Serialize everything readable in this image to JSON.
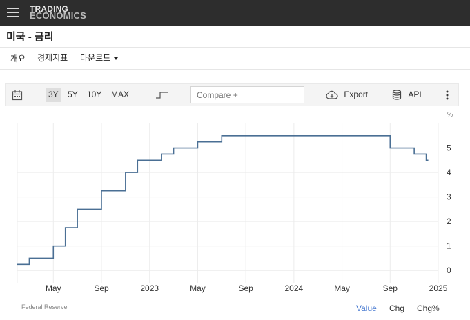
{
  "header": {
    "logo_line1": "TRADING",
    "logo_line2": "ECONOMICS"
  },
  "page": {
    "title": "미국 - 금리"
  },
  "tabs": [
    {
      "label": "개요",
      "active": true
    },
    {
      "label": "경제지표",
      "active": false
    },
    {
      "label": "다운로드",
      "active": false
    }
  ],
  "toolbar": {
    "ranges": [
      "3Y",
      "5Y",
      "10Y",
      "MAX"
    ],
    "selected_range": "3Y",
    "compare_placeholder": "Compare +",
    "export_label": "Export",
    "api_label": "API"
  },
  "chart_data": {
    "type": "line",
    "line_style": "step",
    "ylabel": "%",
    "ylim": [
      -0.5,
      6
    ],
    "y_ticks": [
      0,
      1,
      2,
      3,
      4,
      5
    ],
    "x_ticks": [
      "May",
      "Sep",
      "2023",
      "May",
      "Sep",
      "2024",
      "May",
      "Sep",
      "2025"
    ],
    "grid": true,
    "color": "#4a6f94",
    "series": [
      {
        "x": [
          "2022-02",
          "2022-03",
          "2022-05",
          "2022-06",
          "2022-07",
          "2022-09",
          "2022-11",
          "2022-12",
          "2023-02",
          "2023-03",
          "2023-05",
          "2023-07",
          "2024-09",
          "2024-11",
          "2024-12"
        ],
        "values": [
          0.25,
          0.5,
          1.0,
          1.75,
          2.5,
          3.25,
          4.0,
          4.5,
          4.75,
          5.0,
          5.25,
          5.5,
          5.0,
          4.75,
          4.5
        ]
      }
    ]
  },
  "footer": {
    "source": "Federal Reserve",
    "value_tab": "Value",
    "chg_tab": "Chg",
    "chgpct_tab": "Chg%"
  },
  "colors": {
    "topbar": "#2d2d2d",
    "line": "#4a6f94",
    "active_value": "#4a7bd1"
  },
  "icons": [
    "hamburger-icon",
    "calendar-icon",
    "step-chart-icon",
    "cloud-download-icon",
    "database-icon",
    "more-vertical-icon"
  ]
}
